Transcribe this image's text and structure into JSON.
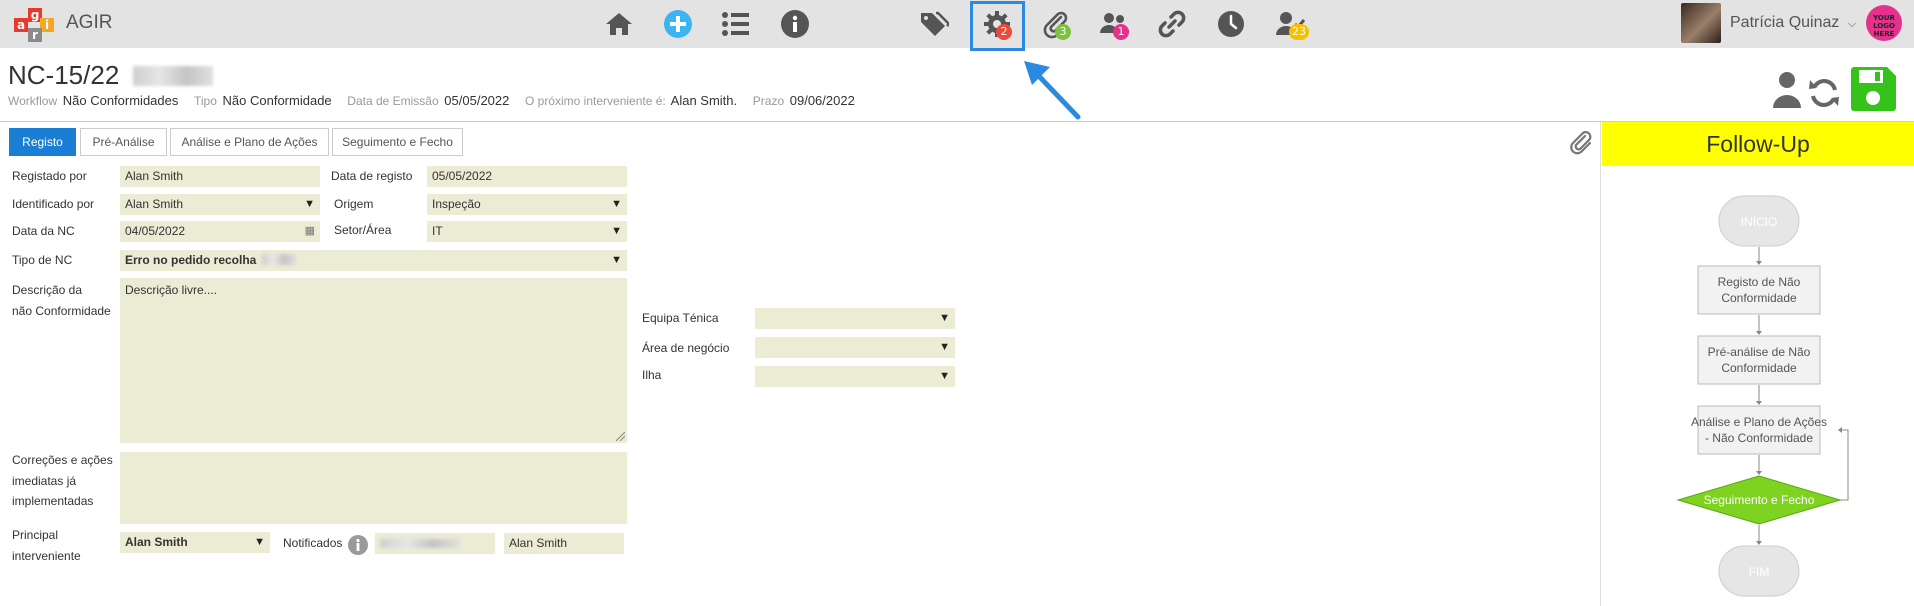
{
  "app": {
    "name": "AGIR",
    "logo_letters": [
      "a",
      "g",
      "i",
      "r"
    ]
  },
  "nav": {
    "icons": [
      {
        "name": "home-icon"
      },
      {
        "name": "add-icon"
      },
      {
        "name": "list-icon"
      },
      {
        "name": "info-icon"
      },
      {
        "name": "tags-icon"
      },
      {
        "name": "gear-icon",
        "badge": "2",
        "badge_color": "#e74c3c"
      },
      {
        "name": "paperclip-icon",
        "badge": "3",
        "badge_color": "#7cc242"
      },
      {
        "name": "users-icon",
        "badge": "1",
        "badge_color": "#e4328c"
      },
      {
        "name": "link-icon"
      },
      {
        "name": "clock-icon"
      },
      {
        "name": "user-check-icon",
        "badge": "23",
        "badge_color": "#f5c000"
      }
    ]
  },
  "user": {
    "name": "Patrícia Quinaz",
    "company_logo_text": "YOUR LOGO HERE"
  },
  "header": {
    "doc_id": "NC-15/22",
    "workflow_label": "Workflow",
    "workflow_value": "Não Conformidades",
    "tipo_label": "Tipo",
    "tipo_value": "Não Conformidade",
    "emissao_label": "Data de Emissão",
    "emissao_value": "05/05/2022",
    "interveniente_label": "O próximo interveniente é:",
    "interveniente_value": "Alan Smith.",
    "prazo_label": "Prazo",
    "prazo_value": "09/06/2022"
  },
  "tabs": [
    "Registo",
    "Pré-Análise",
    "Análise e Plano de Ações",
    "Seguimento e Fecho"
  ],
  "form": {
    "registado_por": {
      "label": "Registado por",
      "value": "Alan Smith"
    },
    "data_registo": {
      "label": "Data de registo",
      "value": "05/05/2022"
    },
    "identificado_por": {
      "label": "Identificado por",
      "value": "Alan Smith"
    },
    "origem": {
      "label": "Origem",
      "value": "Inspeção"
    },
    "data_nc": {
      "label": "Data da NC",
      "value": "04/05/2022"
    },
    "setor": {
      "label": "Setor/Área",
      "value": "IT"
    },
    "tipo_nc": {
      "label": "Tipo de NC",
      "value": "Erro no pedido recolha"
    },
    "descricao": {
      "label_1": "Descrição da",
      "label_2": "não Conformidade",
      "value": "Descrição livre...."
    },
    "correcoes": {
      "label_1": "Correções e ações",
      "label_2": "imediatas já",
      "label_3": "implementadas",
      "value": ""
    },
    "principal": {
      "label_1": "Principal",
      "label_2": "interveniente",
      "value": "Alan Smith"
    },
    "notificados": {
      "label": "Notificados",
      "value": "Alan Smith"
    },
    "equipa": {
      "label": "Equipa Ténica",
      "value": ""
    },
    "area_negocio": {
      "label": "Área de negócio",
      "value": ""
    },
    "ilha": {
      "label": "Ilha",
      "value": ""
    }
  },
  "followup": {
    "title": "Follow-Up",
    "start": "INÍCIO",
    "step1_1": "Registo de Não",
    "step1_2": "Conformidade",
    "step2_1": "Pré-análise de Não",
    "step2_2": "Conformidade",
    "step3_1": "Análise e Plano de Ações",
    "step3_2": "- Não Conformidade",
    "current": "Seguimento e Fecho",
    "current_color": "#7ed321",
    "end": "FIM"
  }
}
